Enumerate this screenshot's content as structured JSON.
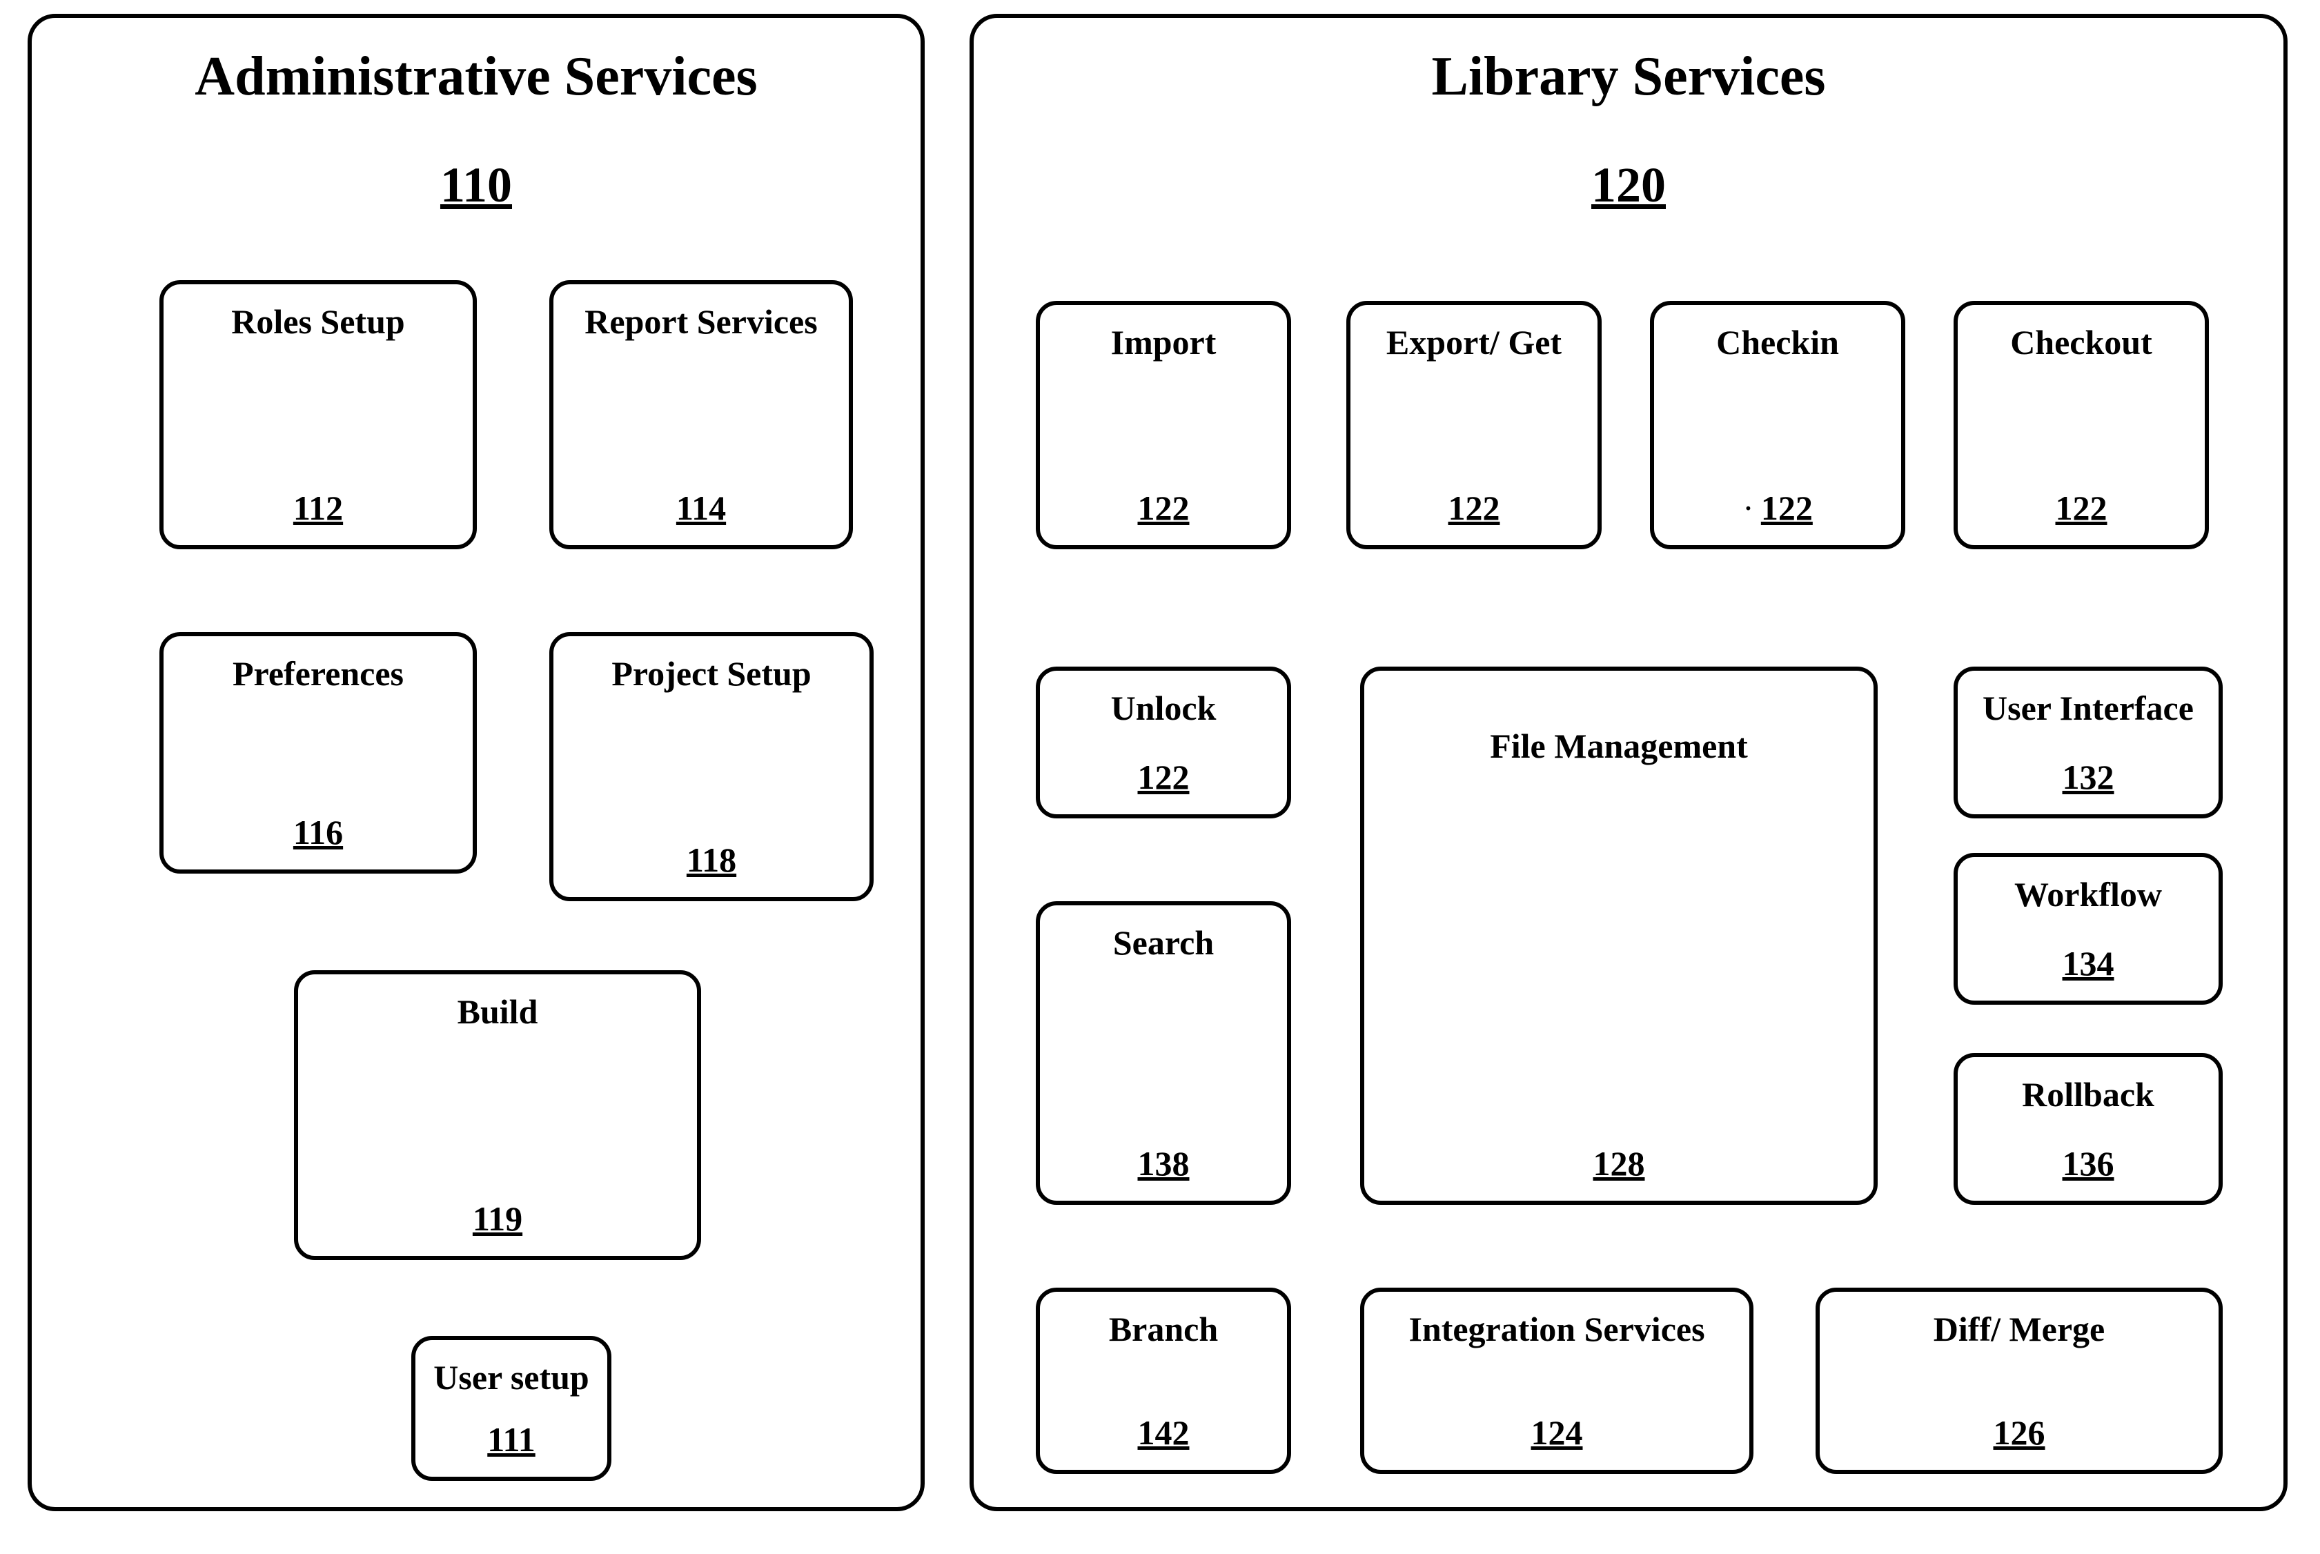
{
  "admin": {
    "title": "Administrative Services",
    "ref": "110",
    "roles": {
      "label": "Roles Setup",
      "ref": "112"
    },
    "report": {
      "label": "Report Services",
      "ref": "114"
    },
    "prefs": {
      "label": "Preferences",
      "ref": "116"
    },
    "project": {
      "label": "Project Setup",
      "ref": "118"
    },
    "build": {
      "label": "Build",
      "ref": "119"
    },
    "user": {
      "label": "User setup",
      "ref": "111"
    }
  },
  "lib": {
    "title": "Library Services",
    "ref": "120",
    "import": {
      "label": "Import",
      "ref": "122"
    },
    "export": {
      "label": "Export/ Get",
      "ref": "122"
    },
    "checkin": {
      "label": "Checkin",
      "ref": "122"
    },
    "checkout": {
      "label": "Checkout",
      "ref": "122"
    },
    "unlock": {
      "label": "Unlock",
      "ref": "122"
    },
    "search": {
      "label": "Search",
      "ref": "138"
    },
    "filemgmt": {
      "label": "File Management",
      "ref": "128"
    },
    "ui": {
      "label": "User Interface",
      "ref": "132"
    },
    "workflow": {
      "label": "Workflow",
      "ref": "134"
    },
    "rollback": {
      "label": "Rollback",
      "ref": "136"
    },
    "branch": {
      "label": "Branch",
      "ref": "142"
    },
    "integ": {
      "label": "Integration Services",
      "ref": "124"
    },
    "diff": {
      "label": "Diff/ Merge",
      "ref": "126"
    }
  }
}
